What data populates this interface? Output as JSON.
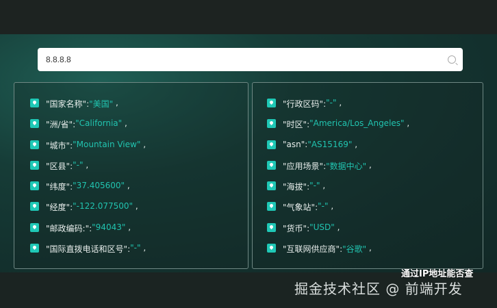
{
  "search": {
    "value": "8.8.8.8"
  },
  "left": [
    {
      "key": "国家名称",
      "value": "美国"
    },
    {
      "key": "洲/省",
      "value": "California"
    },
    {
      "key": "城市",
      "value": "Mountain View"
    },
    {
      "key": "区县",
      "value": "-"
    },
    {
      "key": "纬度",
      "value": "37.405600"
    },
    {
      "key": "经度",
      "value": "-122.077500"
    },
    {
      "key": "邮政编码:",
      "value": "94043"
    },
    {
      "key": "国际直拨电话和区号",
      "value": "-"
    }
  ],
  "right": [
    {
      "key": "行政区码",
      "value": "-"
    },
    {
      "key": "时区",
      "value": "America/Los_Angeles"
    },
    {
      "key": "asn",
      "value": "AS15169"
    },
    {
      "key": "应用场景",
      "value": "数据中心"
    },
    {
      "key": "海拔",
      "value": "-"
    },
    {
      "key": "气象站",
      "value": "-"
    },
    {
      "key": "货币",
      "value": "USD"
    },
    {
      "key": "互联网供应商",
      "value": "谷歌"
    }
  ],
  "watermark": "掘金技术社区 @ 前端开发",
  "overlay": "通过IP地址能否查"
}
